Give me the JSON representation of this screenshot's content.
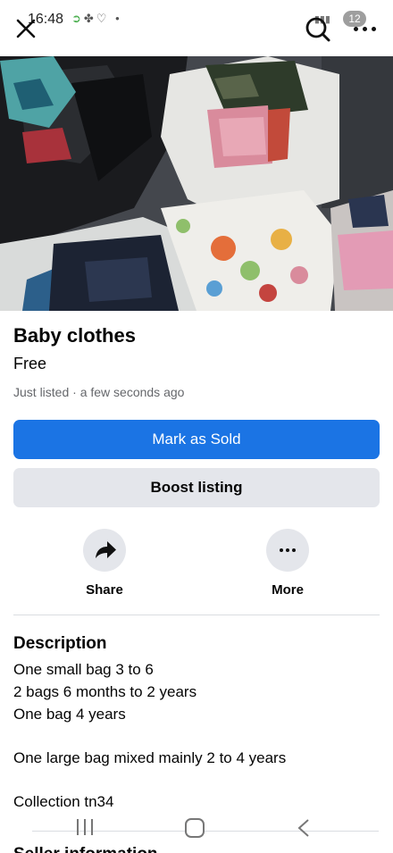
{
  "status_bar": {
    "time": "16:48",
    "notification_count": "12"
  },
  "listing": {
    "title": "Baby clothes",
    "price": "Free",
    "meta": "Just listed · a few seconds ago"
  },
  "buttons": {
    "mark_sold": "Mark as Sold",
    "boost": "Boost listing"
  },
  "actions": {
    "share": "Share",
    "more": "More"
  },
  "description": {
    "heading": "Description",
    "lines": [
      "One small bag 3 to 6",
      "2 bags 6 months to 2 years",
      "One bag 4 years",
      "",
      "One large bag mixed mainly 2 to 4 years",
      "",
      "Collection tn34"
    ]
  },
  "next_section": {
    "heading": "Seller information"
  },
  "colors": {
    "primary": "#1b74e4",
    "secondary_bg": "#e4e6eb",
    "muted_text": "#65676b"
  }
}
